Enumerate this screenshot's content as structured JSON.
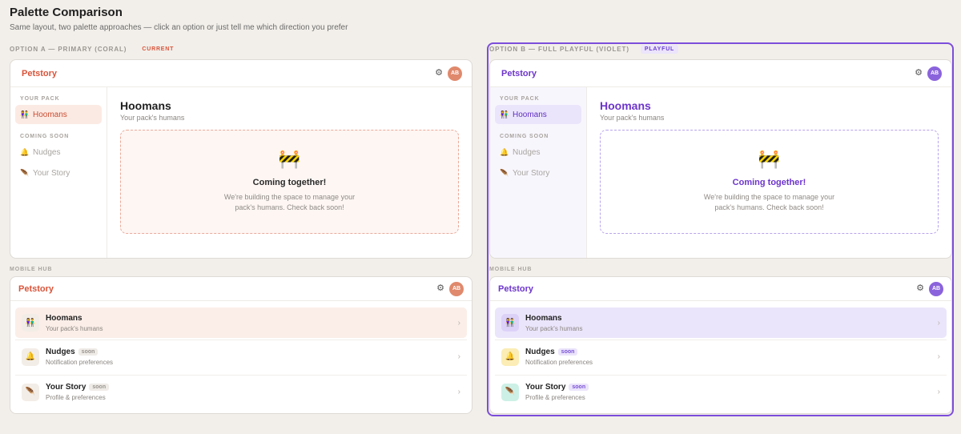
{
  "page": {
    "title": "Palette Comparison",
    "subtitle": "Same layout, two palette approaches — click an option or just tell me which direction you prefer"
  },
  "options": [
    {
      "label": "OPTION A — PRIMARY (CORAL)",
      "badge": "CURRENT",
      "accent": "#d9543a"
    },
    {
      "label": "OPTION B — FULL PLAYFUL (VIOLET)",
      "badge": "PLAYFUL",
      "accent": "#6d35cc"
    }
  ],
  "app": {
    "brand": "Petstory",
    "avatar_initials": "AB",
    "gear_icon": "gear-icon"
  },
  "sidebar": {
    "section_pack": "YOUR PACK",
    "section_soon": "COMING SOON",
    "items": [
      {
        "label": "Hoomans",
        "emoji": "👫"
      },
      {
        "label": "Nudges",
        "emoji": "🔔"
      },
      {
        "label": "Your Story",
        "emoji": "🪶"
      }
    ]
  },
  "main": {
    "title": "Hoomans",
    "subtitle": "Your pack's humans",
    "placeholder_emoji": "🚧",
    "placeholder_title": "Coming together!",
    "placeholder_text": "We're building the space to manage your pack's humans. Check back soon!"
  },
  "mobile": {
    "label": "MOBILE HUB",
    "soon_badge": "soon",
    "items": [
      {
        "title": "Hoomans",
        "sub": "Your pack's humans",
        "emoji": "👫"
      },
      {
        "title": "Nudges",
        "sub": "Notification preferences",
        "emoji": "🔔"
      },
      {
        "title": "Your Story",
        "sub": "Profile & preferences",
        "emoji": "🪶"
      }
    ],
    "chevron": "›"
  }
}
